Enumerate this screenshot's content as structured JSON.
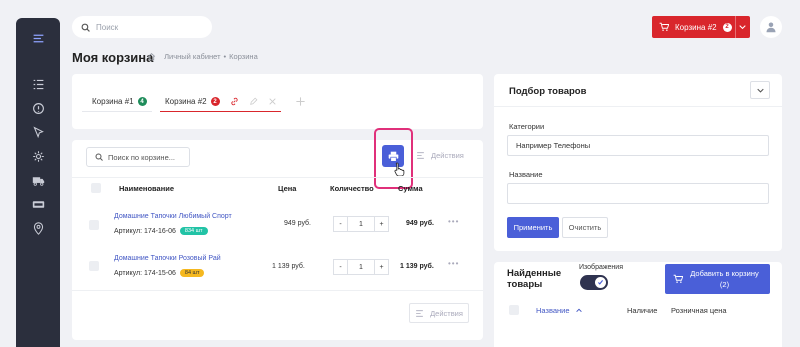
{
  "header": {
    "search_placeholder": "Поиск",
    "cart_button_label": "Корзина #2",
    "cart_badge": "2"
  },
  "page": {
    "title": "Моя корзина",
    "breadcrumbs": [
      "Личный кабинет",
      "Корзина"
    ]
  },
  "tabs": [
    {
      "label": "Корзина #1",
      "badge": "4",
      "badge_color": "#1e8c5a"
    },
    {
      "label": "Корзина #2",
      "badge": "2",
      "badge_color": "#d9262c"
    }
  ],
  "cart": {
    "search_placeholder": "Поиск по корзине...",
    "actions_label": "Действия",
    "columns": [
      "Наименование",
      "Цена",
      "Количество",
      "Сумма"
    ],
    "rows": [
      {
        "name": "Домашние Тапочки Любимый Спорт",
        "article": "Артикул: 174-16-06",
        "stock": "834 шт",
        "stock_color": "#22c3a6",
        "price": "949 руб.",
        "qty": "1",
        "sum": "949 руб."
      },
      {
        "name": "Домашние Тапочки Розовый Рай",
        "article": "Артикул: 174-15-06",
        "stock": "84 шт",
        "stock_color": "#f5b81f",
        "price": "1 139 руб.",
        "qty": "1",
        "sum": "1 139 руб."
      }
    ],
    "qty_minus": "-",
    "qty_plus": "+",
    "bottom_actions_label": "Действия"
  },
  "selection": {
    "title": "Подбор товаров",
    "category_label": "Категории",
    "category_placeholder": "Например Телефоны",
    "name_label": "Название",
    "apply_label": "Применить",
    "clear_label": "Очистить"
  },
  "found": {
    "title": "Найденные товары",
    "images_label": "Изображения",
    "add_button_label": "Добавить в корзину (2)",
    "columns": [
      "Название",
      "Наличие",
      "Розничная цена"
    ]
  },
  "colors": {
    "accent": "#4a5fd8",
    "danger": "#d9262c",
    "sidebar": "#2b2f3d",
    "highlight": "#e0307a"
  }
}
